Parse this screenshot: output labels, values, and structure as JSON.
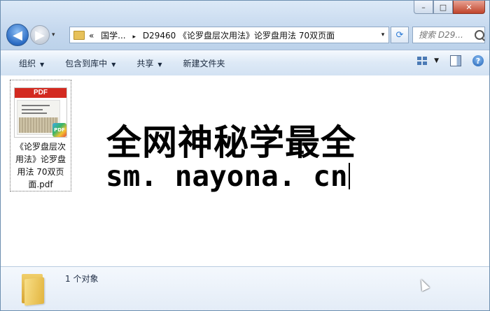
{
  "window": {
    "controls": {
      "minimize": "–",
      "maximize": "□",
      "close": "✕"
    }
  },
  "navigation": {
    "back": "◀",
    "forward": "▶",
    "history_dropdown": "▾"
  },
  "address_bar": {
    "overflow": "«",
    "crumbs": [
      "国学...",
      "D29460 《论罗盘层次用法》论罗盘用法 70双页面"
    ],
    "separator": "▸",
    "dropdown": "▾",
    "refresh": "⟳"
  },
  "search": {
    "placeholder": "搜索 D29..."
  },
  "toolbar": {
    "organize": "组织",
    "include_in_library": "包含到库中",
    "share": "共享",
    "new_folder": "新建文件夹",
    "dropdown_arrow": "▼",
    "help": "?"
  },
  "file": {
    "name_lines": [
      "《论罗盘层次",
      "用法》论罗盘",
      "用法 70双页",
      "面.pdf"
    ],
    "thumb_label": "PDF",
    "badge": "PDF"
  },
  "banner": {
    "line1": "全网神秘学最全",
    "line2": "sm. nayona. cn"
  },
  "details": {
    "object_count": "1 个对象"
  }
}
